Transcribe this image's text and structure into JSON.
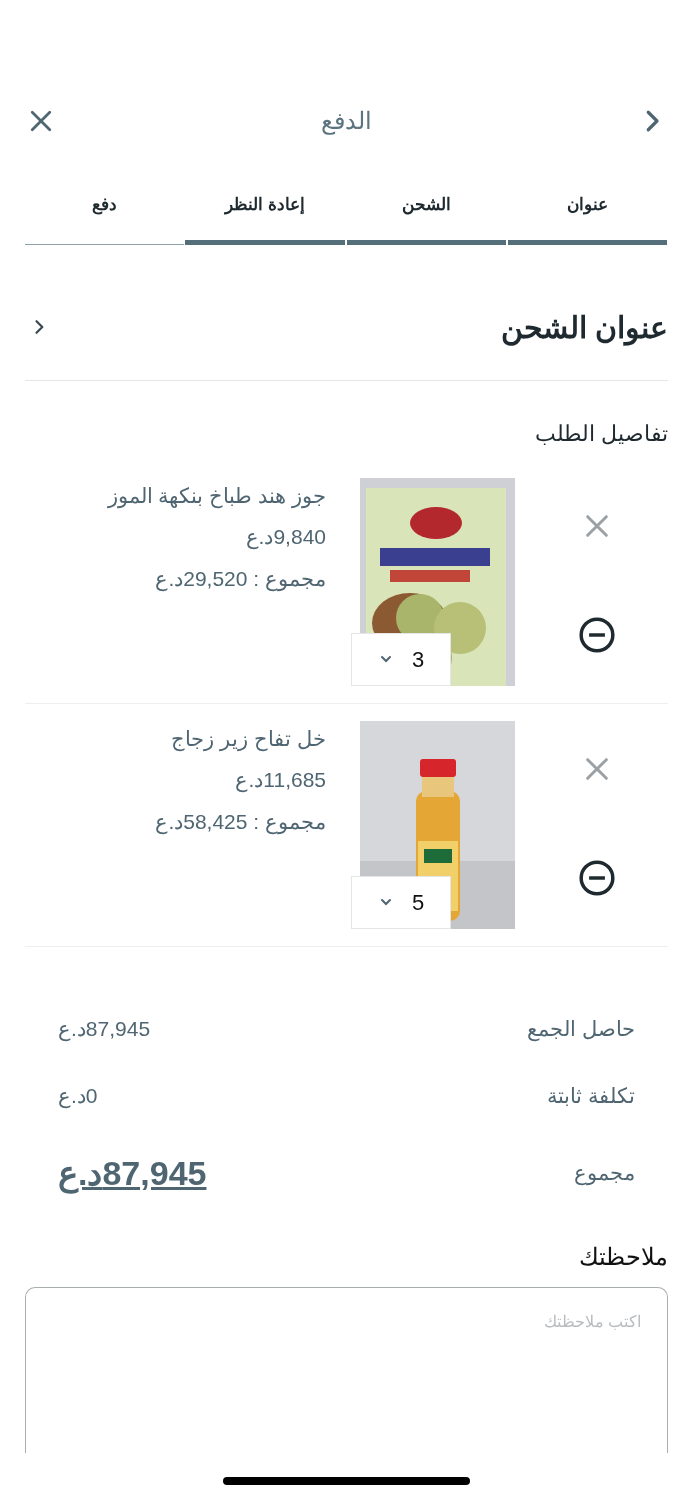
{
  "header": {
    "title": "الدفع"
  },
  "steps": [
    {
      "label": "عنوان",
      "completed": true
    },
    {
      "label": "الشحن",
      "completed": true
    },
    {
      "label": "إعادة النظر",
      "completed": true
    },
    {
      "label": "دفع",
      "completed": false
    }
  ],
  "shipping_address": {
    "title": "عنوان الشحن"
  },
  "order_details": {
    "title": "تفاصيل الطلب",
    "items": [
      {
        "name": "جوز هند طباخ بنكهة الموز",
        "price": "9,840د.ع",
        "total": "مجموع : 29,520د.ع",
        "quantity": "3"
      },
      {
        "name": "خل تفاح زير زجاج",
        "price": "11,685د.ع",
        "total": "مجموع : 58,425د.ع",
        "quantity": "5"
      }
    ]
  },
  "summary": [
    {
      "label": "حاصل الجمع",
      "value": "87,945د.ع",
      "kind": "plain"
    },
    {
      "label": "تكلفة ثابتة",
      "value": "0د.ع",
      "kind": "plain"
    },
    {
      "label": "مجموع",
      "value": "87,945د.ع",
      "kind": "grand"
    }
  ],
  "notes": {
    "title": "ملاحظتك",
    "placeholder": "اكتب ملاحظتك"
  }
}
